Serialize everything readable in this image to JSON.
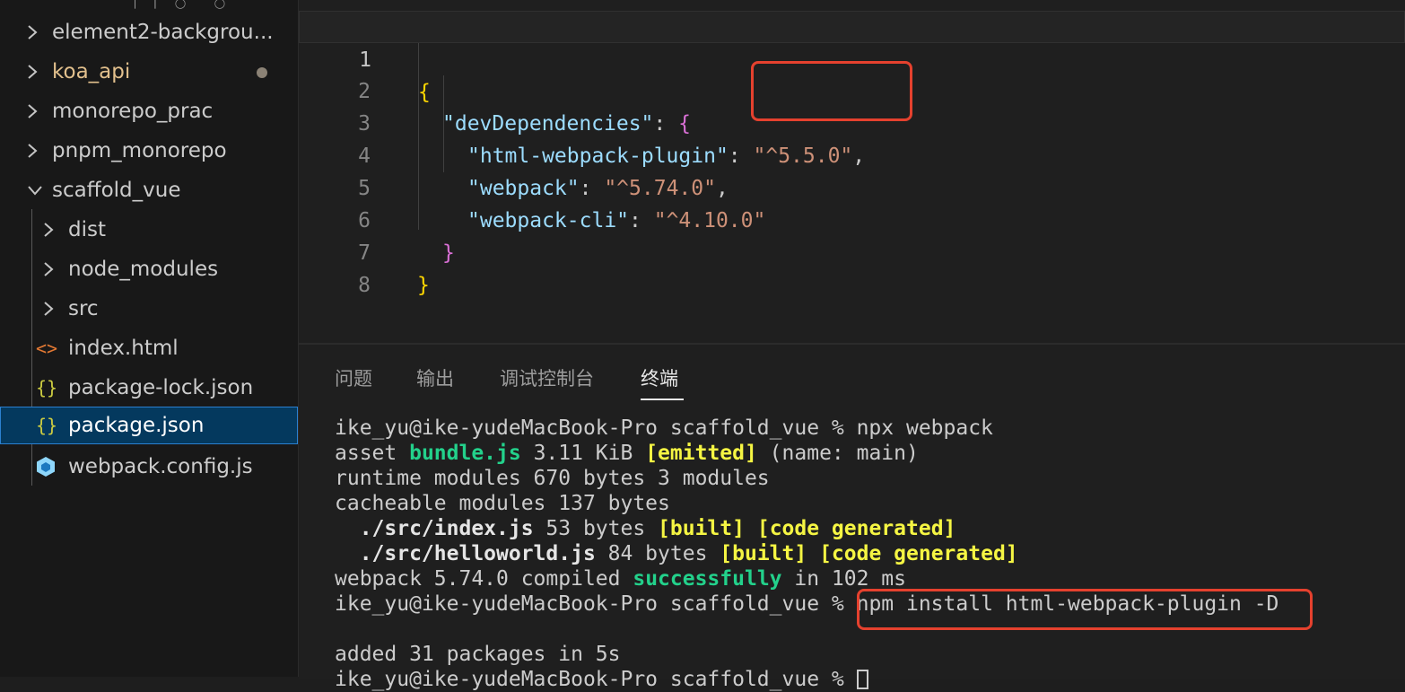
{
  "sidebar": {
    "items": [
      {
        "label": "element2-backgrou..."
      },
      {
        "label": "koa_api"
      },
      {
        "label": "monorepo_prac"
      },
      {
        "label": "pnpm_monorepo"
      },
      {
        "label": "scaffold_vue"
      },
      {
        "label": "dist"
      },
      {
        "label": "node_modules"
      },
      {
        "label": "src"
      },
      {
        "label": "index.html"
      },
      {
        "label": "package-lock.json"
      },
      {
        "label": "package.json"
      },
      {
        "label": "webpack.config.js"
      }
    ],
    "colors": {
      "koa_api": "#e2c08d",
      "selected_bg": "#04395e",
      "selected_border": "#2b80d0"
    }
  },
  "editor": {
    "line_numbers": [
      "1",
      "2",
      "3",
      "4",
      "5",
      "6",
      "7",
      "8"
    ],
    "lines": [
      {
        "open": "{"
      },
      {
        "key": "\"devDependencies\"",
        "colon": ": ",
        "brace": "{"
      },
      {
        "key": "\"html-webpack-plugin\"",
        "colon": ": ",
        "value": "\"^5.5.0\"",
        "comma": ","
      },
      {
        "key": "\"webpack\"",
        "colon": ": ",
        "value": "\"^5.74.0\"",
        "comma": ","
      },
      {
        "key": "\"webpack-cli\"",
        "colon": ": ",
        "value": "\"^4.10.0\""
      },
      {
        "close": "}"
      },
      {
        "close": "}"
      }
    ]
  },
  "panel": {
    "tabs": [
      "问题",
      "输出",
      "调试控制台",
      "终端"
    ],
    "active_tab": "终端",
    "terminal": {
      "l1": "ike_yu@ike-yudeMacBook-Pro scaffold_vue % npx webpack",
      "l2": {
        "a": "asset ",
        "b": "bundle.js",
        "c": " 3.11 KiB ",
        "d": "[emitted]",
        "e": " (name: main)"
      },
      "l3": "runtime modules 670 bytes 3 modules",
      "l4": "cacheable modules 137 bytes",
      "l5": {
        "a": "  ./src/index.js",
        "b": " 53 bytes ",
        "c": "[built]",
        "d": " ",
        "e": "[code generated]"
      },
      "l6": {
        "a": "  ./src/helloworld.js",
        "b": " 84 bytes ",
        "c": "[built]",
        "d": " ",
        "e": "[code generated]"
      },
      "l7": {
        "a": "webpack 5.74.0 compiled ",
        "b": "successfully",
        "c": " in 102 ms"
      },
      "l8": {
        "a": "ike_yu@ike-yudeMacBook-Pro scaffold_vue % ",
        "b": "npm install html-webpack-plugin -D"
      },
      "l9": "added 31 packages in 5s",
      "l10": "ike_yu@ike-yudeMacBook-Pro scaffold_vue % "
    }
  },
  "highlight_color": "#e5412e"
}
